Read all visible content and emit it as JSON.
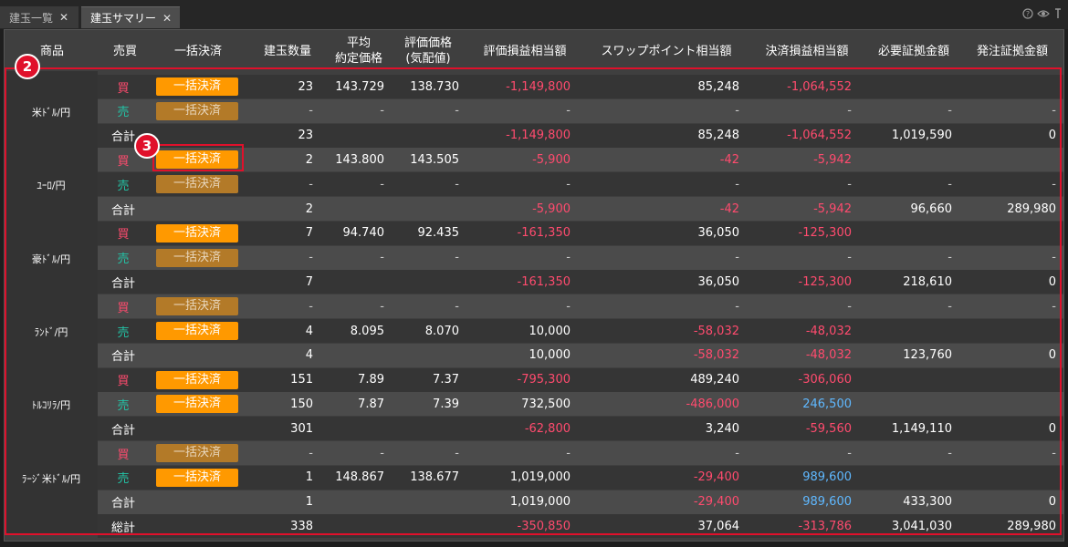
{
  "tabs": [
    {
      "label": "建玉一覧",
      "active": false
    },
    {
      "label": "建玉サマリー",
      "active": true
    }
  ],
  "window_icons": [
    "help-icon",
    "eye-icon",
    "pin-icon"
  ],
  "headers": {
    "product": "商品",
    "side": "売買",
    "bulk": "一括決済",
    "qty": "建玉数量",
    "avg": "平均\n約定価格",
    "eval": "評価価格\n(気配値)",
    "pl": "評価損益相当額",
    "swap": "スワップポイント相当額",
    "settle": "決済損益相当額",
    "margin": "必要証拠金額",
    "order_margin": "発注証拠金額"
  },
  "button_label": "一括決済",
  "badges": [
    "2",
    "3"
  ],
  "colors": {
    "buy": "#ff4b6e",
    "sell": "#22c7a9",
    "negative": "#ff4b6e",
    "positive": "#5fb8ff",
    "button": "#ff9900",
    "highlight": "#e0102b"
  },
  "products": [
    {
      "name": "米ﾄﾞﾙ/円",
      "rows": [
        {
          "side": "買",
          "type": "buy",
          "btn": "on",
          "qty": "23",
          "avg": "143.729",
          "eval": "138.730",
          "pl": "-1,149,800",
          "pl_c": "neg",
          "swap": "85,248",
          "swap_c": "",
          "settle": "-1,064,552",
          "settle_c": "neg",
          "margin": "",
          "om": ""
        },
        {
          "side": "売",
          "type": "sell",
          "btn": "off",
          "qty": "-",
          "avg": "-",
          "eval": "-",
          "pl": "-",
          "pl_c": "dash",
          "swap": "-",
          "swap_c": "dash",
          "settle": "-",
          "settle_c": "dash",
          "margin": "-",
          "om": "-"
        },
        {
          "side": "合計",
          "type": "total",
          "btn": "",
          "qty": "23",
          "avg": "",
          "eval": "",
          "pl": "-1,149,800",
          "pl_c": "neg",
          "swap": "85,248",
          "swap_c": "",
          "settle": "-1,064,552",
          "settle_c": "neg",
          "margin": "1,019,590",
          "om": "0"
        }
      ]
    },
    {
      "name": "ﾕｰﾛ/円",
      "rows": [
        {
          "side": "買",
          "type": "buy",
          "btn": "on",
          "qty": "2",
          "avg": "143.800",
          "eval": "143.505",
          "pl": "-5,900",
          "pl_c": "neg",
          "swap": "-42",
          "swap_c": "neg",
          "settle": "-5,942",
          "settle_c": "neg",
          "margin": "",
          "om": ""
        },
        {
          "side": "売",
          "type": "sell",
          "btn": "off",
          "qty": "-",
          "avg": "-",
          "eval": "-",
          "pl": "-",
          "pl_c": "dash",
          "swap": "-",
          "swap_c": "dash",
          "settle": "-",
          "settle_c": "dash",
          "margin": "-",
          "om": "-"
        },
        {
          "side": "合計",
          "type": "total",
          "btn": "",
          "qty": "2",
          "avg": "",
          "eval": "",
          "pl": "-5,900",
          "pl_c": "neg",
          "swap": "-42",
          "swap_c": "neg",
          "settle": "-5,942",
          "settle_c": "neg",
          "margin": "96,660",
          "om": "289,980"
        }
      ]
    },
    {
      "name": "豪ﾄﾞﾙ/円",
      "rows": [
        {
          "side": "買",
          "type": "buy",
          "btn": "on",
          "qty": "7",
          "avg": "94.740",
          "eval": "92.435",
          "pl": "-161,350",
          "pl_c": "neg",
          "swap": "36,050",
          "swap_c": "",
          "settle": "-125,300",
          "settle_c": "neg",
          "margin": "",
          "om": ""
        },
        {
          "side": "売",
          "type": "sell",
          "btn": "off",
          "qty": "-",
          "avg": "-",
          "eval": "-",
          "pl": "-",
          "pl_c": "dash",
          "swap": "-",
          "swap_c": "dash",
          "settle": "-",
          "settle_c": "dash",
          "margin": "-",
          "om": "-"
        },
        {
          "side": "合計",
          "type": "total",
          "btn": "",
          "qty": "7",
          "avg": "",
          "eval": "",
          "pl": "-161,350",
          "pl_c": "neg",
          "swap": "36,050",
          "swap_c": "",
          "settle": "-125,300",
          "settle_c": "neg",
          "margin": "218,610",
          "om": "0"
        }
      ]
    },
    {
      "name": "ﾗﾝﾄﾞ/円",
      "rows": [
        {
          "side": "買",
          "type": "buy",
          "btn": "off",
          "qty": "-",
          "avg": "-",
          "eval": "-",
          "pl": "-",
          "pl_c": "dash",
          "swap": "-",
          "swap_c": "dash",
          "settle": "-",
          "settle_c": "dash",
          "margin": "-",
          "om": "-"
        },
        {
          "side": "売",
          "type": "sell",
          "btn": "on",
          "qty": "4",
          "avg": "8.095",
          "eval": "8.070",
          "pl": "10,000",
          "pl_c": "",
          "swap": "-58,032",
          "swap_c": "neg",
          "settle": "-48,032",
          "settle_c": "neg",
          "margin": "",
          "om": ""
        },
        {
          "side": "合計",
          "type": "total",
          "btn": "",
          "qty": "4",
          "avg": "",
          "eval": "",
          "pl": "10,000",
          "pl_c": "",
          "swap": "-58,032",
          "swap_c": "neg",
          "settle": "-48,032",
          "settle_c": "neg",
          "margin": "123,760",
          "om": "0"
        }
      ]
    },
    {
      "name": "ﾄﾙｺﾘﾗ/円",
      "rows": [
        {
          "side": "買",
          "type": "buy",
          "btn": "on",
          "qty": "151",
          "avg": "7.89",
          "eval": "7.37",
          "pl": "-795,300",
          "pl_c": "neg",
          "swap": "489,240",
          "swap_c": "",
          "settle": "-306,060",
          "settle_c": "neg",
          "margin": "",
          "om": ""
        },
        {
          "side": "売",
          "type": "sell",
          "btn": "on",
          "qty": "150",
          "avg": "7.87",
          "eval": "7.39",
          "pl": "732,500",
          "pl_c": "",
          "swap": "-486,000",
          "swap_c": "neg",
          "settle": "246,500",
          "settle_c": "pos",
          "margin": "",
          "om": ""
        },
        {
          "side": "合計",
          "type": "total",
          "btn": "",
          "qty": "301",
          "avg": "",
          "eval": "",
          "pl": "-62,800",
          "pl_c": "neg",
          "swap": "3,240",
          "swap_c": "",
          "settle": "-59,560",
          "settle_c": "neg",
          "margin": "1,149,110",
          "om": "0"
        }
      ]
    },
    {
      "name": "ﾗｰｼﾞ米ﾄﾞﾙ/円",
      "rows": [
        {
          "side": "買",
          "type": "buy",
          "btn": "off",
          "qty": "-",
          "avg": "-",
          "eval": "-",
          "pl": "-",
          "pl_c": "dash",
          "swap": "-",
          "swap_c": "dash",
          "settle": "-",
          "settle_c": "dash",
          "margin": "-",
          "om": "-"
        },
        {
          "side": "売",
          "type": "sell",
          "btn": "on",
          "qty": "1",
          "avg": "148.867",
          "eval": "138.677",
          "pl": "1,019,000",
          "pl_c": "",
          "swap": "-29,400",
          "swap_c": "neg",
          "settle": "989,600",
          "settle_c": "pos",
          "margin": "",
          "om": ""
        },
        {
          "side": "合計",
          "type": "total",
          "btn": "",
          "qty": "1",
          "avg": "",
          "eval": "",
          "pl": "1,019,000",
          "pl_c": "",
          "swap": "-29,400",
          "swap_c": "neg",
          "settle": "989,600",
          "settle_c": "pos",
          "margin": "433,300",
          "om": "0"
        }
      ]
    }
  ],
  "grand_total": {
    "side": "総計",
    "qty": "338",
    "pl": "-350,850",
    "pl_c": "neg",
    "swap": "37,064",
    "swap_c": "",
    "settle": "-313,786",
    "settle_c": "neg",
    "margin": "3,041,030",
    "om": "289,980"
  }
}
